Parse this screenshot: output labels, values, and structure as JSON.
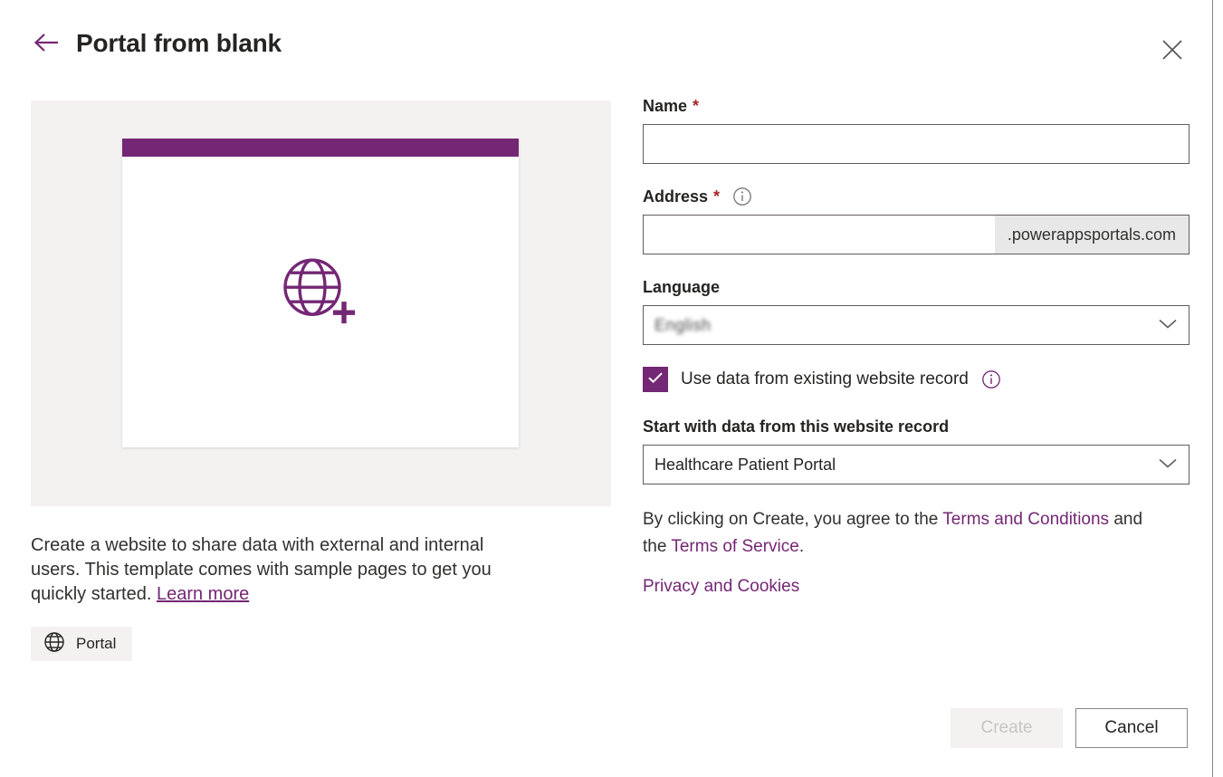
{
  "header": {
    "title": "Portal from blank",
    "back_icon": "arrow-left-icon",
    "close_icon": "close-icon"
  },
  "preview": {
    "icon": "globe-add-icon",
    "accent_color": "#742774",
    "background_color": "#f3f2f1",
    "card_color": "#ffffff"
  },
  "left": {
    "description_before": "Create a website to share data with external and internal users. This template comes with sample pages to get you quickly started. ",
    "learn_more": "Learn more",
    "tag_label": "Portal",
    "tag_icon": "globe-icon"
  },
  "form": {
    "name": {
      "label": "Name",
      "required_marker": "*",
      "value": "",
      "placeholder": ""
    },
    "address": {
      "label": "Address",
      "required_marker": "*",
      "info_icon": "info-icon",
      "value": "",
      "placeholder": "",
      "suffix": ".powerappsportals.com"
    },
    "language": {
      "label": "Language",
      "value": "English",
      "redacted": true,
      "chevron_icon": "chevron-down-icon"
    },
    "use_existing": {
      "label": "Use data from existing website record",
      "checked": true,
      "check_icon": "checkmark-icon",
      "info_icon": "info-icon"
    },
    "website_record": {
      "label": "Start with data from this website record",
      "value": "Healthcare Patient Portal",
      "chevron_icon": "chevron-down-icon"
    }
  },
  "legal": {
    "text_1": "By clicking on Create, you agree to the ",
    "link_terms_conditions": "Terms and Conditions",
    "text_2": " and the ",
    "link_terms_service": "Terms of Service",
    "text_3": ".",
    "link_privacy": "Privacy and Cookies"
  },
  "footer": {
    "create_label": "Create",
    "create_disabled": true,
    "cancel_label": "Cancel"
  },
  "colors": {
    "accent": "#742774",
    "required": "#a4262c",
    "border": "#605e5c"
  }
}
